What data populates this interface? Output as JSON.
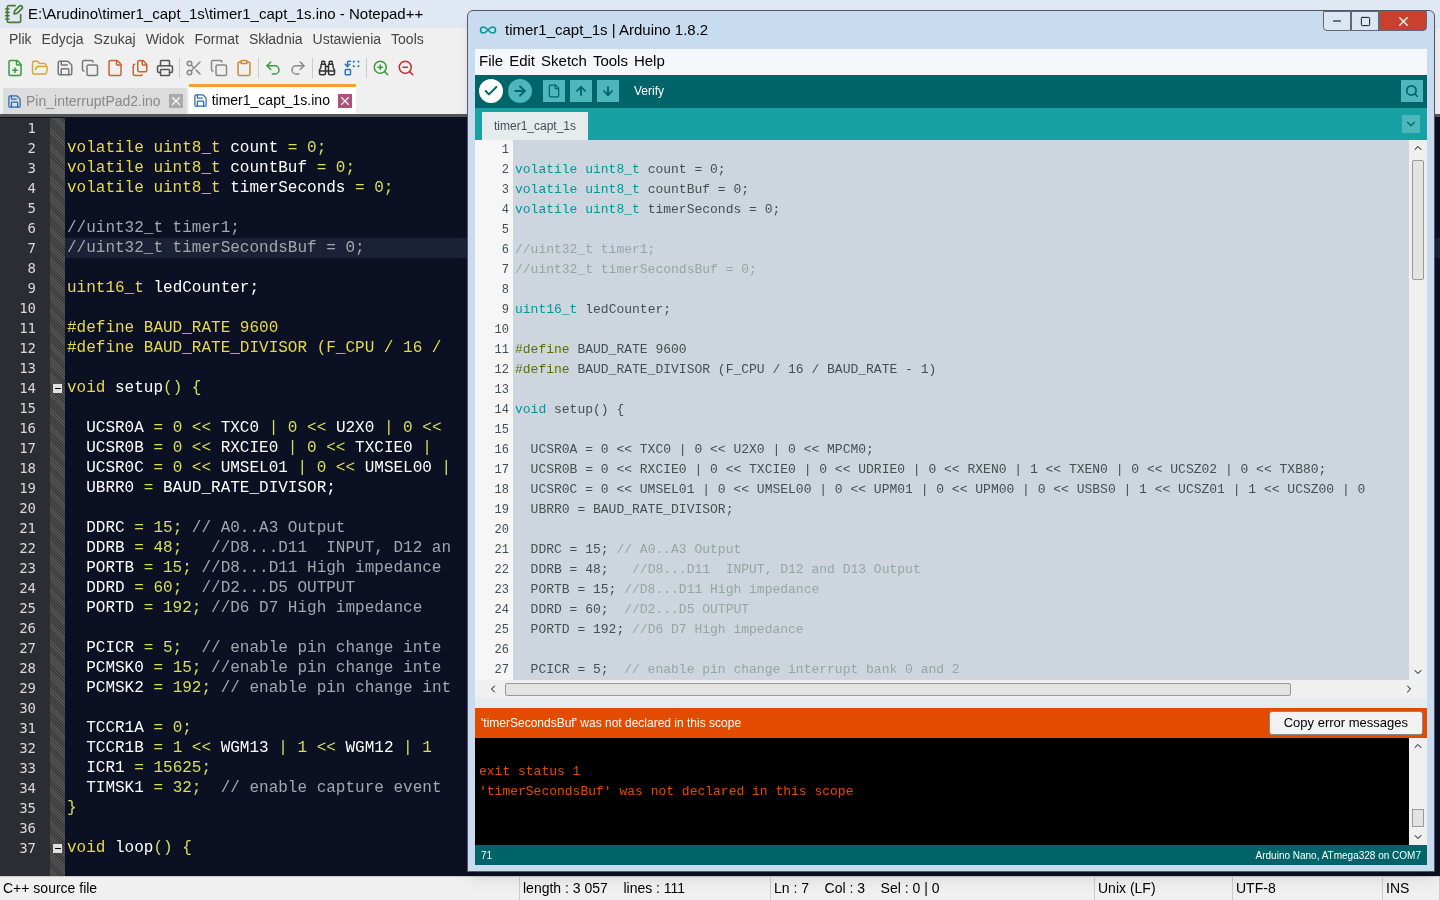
{
  "notepad": {
    "title": "E:\\Arudino\\timer1_capt_1s\\timer1_capt_1s.ino - Notepad++",
    "menu": [
      "Plik",
      "Edycja",
      "Szukaj",
      "Widok",
      "Format",
      "Składnia",
      "Ustawienia",
      "Tools"
    ],
    "tabs": [
      {
        "label": "Pin_interruptPad2.ino",
        "selected": false
      },
      {
        "label": "timer1_capt_1s.ino",
        "selected": true
      }
    ],
    "lines": [
      {
        "n": "1",
        "current": false,
        "fold": false
      },
      {
        "n": "2",
        "current": false,
        "fold": false,
        "segs": [
          {
            "kind": "type",
            "text": "volatile uint8_t "
          },
          {
            "kind": "plain",
            "text": "count "
          },
          {
            "kind": "num",
            "text": "= 0;"
          }
        ]
      },
      {
        "n": "3",
        "current": false,
        "fold": false,
        "segs": [
          {
            "kind": "type",
            "text": "volatile uint8_t "
          },
          {
            "kind": "plain",
            "text": "countBuf "
          },
          {
            "kind": "num",
            "text": "= 0;"
          }
        ]
      },
      {
        "n": "4",
        "current": false,
        "fold": false,
        "segs": [
          {
            "kind": "type",
            "text": "volatile uint8_t "
          },
          {
            "kind": "plain",
            "text": "timerSeconds "
          },
          {
            "kind": "num",
            "text": "= 0;"
          }
        ]
      },
      {
        "n": "5",
        "current": false,
        "fold": false
      },
      {
        "n": "6",
        "current": false,
        "fold": false,
        "segs": [
          {
            "kind": "comment",
            "text": "//uint32_t timer1;"
          }
        ]
      },
      {
        "n": "7",
        "current": true,
        "fold": false,
        "segs": [
          {
            "kind": "comment",
            "text": "//uint32_t timerSecondsBuf = 0;"
          }
        ]
      },
      {
        "n": "8",
        "current": false,
        "fold": false
      },
      {
        "n": "9",
        "current": false,
        "fold": false,
        "segs": [
          {
            "kind": "type",
            "text": "uint16_t "
          },
          {
            "kind": "plain",
            "text": "ledCounter;"
          }
        ]
      },
      {
        "n": "10",
        "current": false,
        "fold": false
      },
      {
        "n": "11",
        "current": false,
        "fold": false,
        "segs": [
          {
            "kind": "type",
            "text": "#define BAUD_RATE 9600"
          }
        ]
      },
      {
        "n": "12",
        "current": false,
        "fold": false,
        "segs": [
          {
            "kind": "type",
            "text": "#define BAUD_RATE_DIVISOR (F_CPU / 16 /"
          }
        ]
      },
      {
        "n": "13",
        "current": false,
        "fold": false
      },
      {
        "n": "14",
        "current": false,
        "fold": true,
        "segs": [
          {
            "kind": "type",
            "text": "void "
          },
          {
            "kind": "plain",
            "text": "setup"
          },
          {
            "kind": "num",
            "text": "() {"
          }
        ]
      },
      {
        "n": "15",
        "current": false,
        "fold": false
      },
      {
        "n": "16",
        "current": false,
        "fold": false,
        "segs": [
          {
            "kind": "plain",
            "text": "  UCSR0A "
          },
          {
            "kind": "num",
            "text": "= 0 << "
          },
          {
            "kind": "plain",
            "text": "TXC0 "
          },
          {
            "kind": "num",
            "text": "| 0 << "
          },
          {
            "kind": "plain",
            "text": "U2X0 "
          },
          {
            "kind": "num",
            "text": "| 0 <<"
          }
        ]
      },
      {
        "n": "17",
        "current": false,
        "fold": false,
        "segs": [
          {
            "kind": "plain",
            "text": "  UCSR0B "
          },
          {
            "kind": "num",
            "text": "= 0 << "
          },
          {
            "kind": "plain",
            "text": "RXCIE0 "
          },
          {
            "kind": "num",
            "text": "| 0 << "
          },
          {
            "kind": "plain",
            "text": "TXCIE0 "
          },
          {
            "kind": "num",
            "text": "|"
          }
        ]
      },
      {
        "n": "18",
        "current": false,
        "fold": false,
        "segs": [
          {
            "kind": "plain",
            "text": "  UCSR0C "
          },
          {
            "kind": "num",
            "text": "= 0 << "
          },
          {
            "kind": "plain",
            "text": "UMSEL01 "
          },
          {
            "kind": "num",
            "text": "| 0 << "
          },
          {
            "kind": "plain",
            "text": "UMSEL00 "
          },
          {
            "kind": "num",
            "text": "|"
          }
        ]
      },
      {
        "n": "19",
        "current": false,
        "fold": false,
        "segs": [
          {
            "kind": "plain",
            "text": "  UBRR0 "
          },
          {
            "kind": "num",
            "text": "= "
          },
          {
            "kind": "plain",
            "text": "BAUD_RATE_DIVISOR;"
          }
        ]
      },
      {
        "n": "20",
        "current": false,
        "fold": false
      },
      {
        "n": "21",
        "current": false,
        "fold": false,
        "segs": [
          {
            "kind": "plain",
            "text": "  DDRC "
          },
          {
            "kind": "num",
            "text": "= 15; "
          },
          {
            "kind": "comment",
            "text": "// A0..A3 Output"
          }
        ]
      },
      {
        "n": "22",
        "current": false,
        "fold": false,
        "segs": [
          {
            "kind": "plain",
            "text": "  DDRB "
          },
          {
            "kind": "num",
            "text": "= 48;   "
          },
          {
            "kind": "comment",
            "text": "//D8...D11  INPUT, D12 an"
          }
        ]
      },
      {
        "n": "23",
        "current": false,
        "fold": false,
        "segs": [
          {
            "kind": "plain",
            "text": "  PORTB "
          },
          {
            "kind": "num",
            "text": "= 15; "
          },
          {
            "kind": "comment",
            "text": "//D8...D11 High impedance"
          }
        ]
      },
      {
        "n": "24",
        "current": false,
        "fold": false,
        "segs": [
          {
            "kind": "plain",
            "text": "  DDRD "
          },
          {
            "kind": "num",
            "text": "= 60;  "
          },
          {
            "kind": "comment",
            "text": "//D2...D5 OUTPUT"
          }
        ]
      },
      {
        "n": "25",
        "current": false,
        "fold": false,
        "segs": [
          {
            "kind": "plain",
            "text": "  PORTD "
          },
          {
            "kind": "num",
            "text": "= 192; "
          },
          {
            "kind": "comment",
            "text": "//D6 D7 High impedance"
          }
        ]
      },
      {
        "n": "26",
        "current": false,
        "fold": false
      },
      {
        "n": "27",
        "current": false,
        "fold": false,
        "segs": [
          {
            "kind": "plain",
            "text": "  PCICR "
          },
          {
            "kind": "num",
            "text": "= 5;  "
          },
          {
            "kind": "comment",
            "text": "// enable pin change inte"
          }
        ]
      },
      {
        "n": "28",
        "current": false,
        "fold": false,
        "segs": [
          {
            "kind": "plain",
            "text": "  PCMSK0 "
          },
          {
            "kind": "num",
            "text": "= 15; "
          },
          {
            "kind": "comment",
            "text": "//enable pin change inte"
          }
        ]
      },
      {
        "n": "29",
        "current": false,
        "fold": false,
        "segs": [
          {
            "kind": "plain",
            "text": "  PCMSK2 "
          },
          {
            "kind": "num",
            "text": "= 192; "
          },
          {
            "kind": "comment",
            "text": "// enable pin change int"
          }
        ]
      },
      {
        "n": "30",
        "current": false,
        "fold": false
      },
      {
        "n": "31",
        "current": false,
        "fold": false,
        "segs": [
          {
            "kind": "plain",
            "text": "  TCCR1A "
          },
          {
            "kind": "num",
            "text": "= 0;"
          }
        ]
      },
      {
        "n": "32",
        "current": false,
        "fold": false,
        "segs": [
          {
            "kind": "plain",
            "text": "  TCCR1B "
          },
          {
            "kind": "num",
            "text": "= 1 << "
          },
          {
            "kind": "plain",
            "text": "WGM13 "
          },
          {
            "kind": "num",
            "text": "| 1 << "
          },
          {
            "kind": "plain",
            "text": "WGM12 "
          },
          {
            "kind": "num",
            "text": "| 1"
          }
        ]
      },
      {
        "n": "33",
        "current": false,
        "fold": false,
        "segs": [
          {
            "kind": "plain",
            "text": "  ICR1 "
          },
          {
            "kind": "num",
            "text": "= 15625;"
          }
        ]
      },
      {
        "n": "34",
        "current": false,
        "fold": false,
        "segs": [
          {
            "kind": "plain",
            "text": "  TIMSK1 "
          },
          {
            "kind": "num",
            "text": "= 32;  "
          },
          {
            "kind": "comment",
            "text": "// enable capture event"
          }
        ]
      },
      {
        "n": "35",
        "current": false,
        "fold": false,
        "segs": [
          {
            "kind": "num",
            "text": "}"
          }
        ]
      },
      {
        "n": "36",
        "current": false,
        "fold": false
      },
      {
        "n": "37",
        "current": false,
        "fold": true,
        "segs": [
          {
            "kind": "type",
            "text": "void "
          },
          {
            "kind": "plain",
            "text": "loop"
          },
          {
            "kind": "num",
            "text": "() {"
          }
        ]
      }
    ],
    "status_bar": [
      "C++ source file",
      "length : 3 057    lines : 111",
      "Ln : 7    Col : 3    Sel : 0 | 0",
      "Unix (LF)",
      "UTF-8",
      "INS"
    ]
  },
  "arduino": {
    "title": "timer1_capt_1s | Arduino 1.8.2",
    "menu": [
      "File",
      "Edit",
      "Sketch",
      "Tools",
      "Help"
    ],
    "toolbar_label": "Verify",
    "tabs": [
      {
        "label": "timer1_capt_1s",
        "selected": true
      }
    ],
    "lines": [
      {
        "n": "1"
      },
      {
        "n": "2",
        "segs": [
          {
            "kind": "type",
            "text": "volatile uint8_t"
          },
          {
            "kind": "plain",
            "text": " count = 0;"
          }
        ]
      },
      {
        "n": "3",
        "segs": [
          {
            "kind": "type",
            "text": "volatile uint8_t"
          },
          {
            "kind": "plain",
            "text": " countBuf = 0;"
          }
        ]
      },
      {
        "n": "4",
        "segs": [
          {
            "kind": "type",
            "text": "volatile uint8_t"
          },
          {
            "kind": "plain",
            "text": " timerSeconds = 0;"
          }
        ]
      },
      {
        "n": "5"
      },
      {
        "n": "6",
        "segs": [
          {
            "kind": "comment",
            "text": "//uint32_t timer1;"
          }
        ]
      },
      {
        "n": "7",
        "segs": [
          {
            "kind": "comment",
            "text": "//uint32_t timerSecondsBuf = 0;"
          }
        ]
      },
      {
        "n": "8"
      },
      {
        "n": "9",
        "segs": [
          {
            "kind": "type",
            "text": "uint16_t"
          },
          {
            "kind": "plain",
            "text": " ledCounter;"
          }
        ]
      },
      {
        "n": "10"
      },
      {
        "n": "11",
        "segs": [
          {
            "kind": "directive",
            "text": "#define"
          },
          {
            "kind": "plain",
            "text": " BAUD_RATE 9600"
          }
        ]
      },
      {
        "n": "12",
        "segs": [
          {
            "kind": "directive",
            "text": "#define"
          },
          {
            "kind": "plain",
            "text": " BAUD_RATE_DIVISOR (F_CPU / 16 / BAUD_RATE - 1)"
          }
        ]
      },
      {
        "n": "13"
      },
      {
        "n": "14",
        "segs": [
          {
            "kind": "type",
            "text": "void"
          },
          {
            "kind": "plain",
            "text": " setup() {"
          }
        ]
      },
      {
        "n": "15"
      },
      {
        "n": "16",
        "segs": [
          {
            "kind": "plain",
            "text": "  UCSR0A = 0 << TXC0 | 0 << U2X0 | 0 << MPCM0;"
          }
        ]
      },
      {
        "n": "17",
        "segs": [
          {
            "kind": "plain",
            "text": "  UCSR0B = 0 << RXCIE0 | 0 << TXCIE0 | 0 << UDRIE0 | 0 << RXEN0 | 1 << TXEN0 | 0 << UCSZ02 | 0 << TXB80;"
          }
        ]
      },
      {
        "n": "18",
        "segs": [
          {
            "kind": "plain",
            "text": "  UCSR0C = 0 << UMSEL01 | 0 << UMSEL00 | 0 << UPM01 | 0 << UPM00 | 0 << USBS0 | 1 << UCSZ01 | 1 << UCSZ00 | 0"
          }
        ]
      },
      {
        "n": "19",
        "segs": [
          {
            "kind": "plain",
            "text": "  UBRR0 = BAUD_RATE_DIVISOR;"
          }
        ]
      },
      {
        "n": "20"
      },
      {
        "n": "21",
        "segs": [
          {
            "kind": "plain",
            "text": "  DDRC = 15; "
          },
          {
            "kind": "comment",
            "text": "// A0..A3 Output"
          }
        ]
      },
      {
        "n": "22",
        "segs": [
          {
            "kind": "plain",
            "text": "  DDRB = 48;   "
          },
          {
            "kind": "comment",
            "text": "//D8...D11  INPUT, D12 and D13 Output"
          }
        ]
      },
      {
        "n": "23",
        "segs": [
          {
            "kind": "plain",
            "text": "  PORTB = 15; "
          },
          {
            "kind": "comment",
            "text": "//D8...D11 High impedance"
          }
        ]
      },
      {
        "n": "24",
        "segs": [
          {
            "kind": "plain",
            "text": "  DDRD = 60;  "
          },
          {
            "kind": "comment",
            "text": "//D2...D5 OUTPUT"
          }
        ]
      },
      {
        "n": "25",
        "segs": [
          {
            "kind": "plain",
            "text": "  PORTD = 192; "
          },
          {
            "kind": "comment",
            "text": "//D6 D7 High impedance"
          }
        ]
      },
      {
        "n": "26"
      },
      {
        "n": "27",
        "segs": [
          {
            "kind": "plain",
            "text": "  PCICR = 5;  "
          },
          {
            "kind": "comment",
            "text": "// enable pin change interrupt bank 0 and 2"
          }
        ]
      }
    ],
    "error_message": "'timerSecondsBuf' was not declared in this scope",
    "copy_button": "Copy error messages",
    "console": [
      "exit status 1",
      "'timerSecondsBuf' was not declared in this scope"
    ],
    "status_line": "71",
    "board": "Arduino Nano, ATmega328 on COM7"
  }
}
